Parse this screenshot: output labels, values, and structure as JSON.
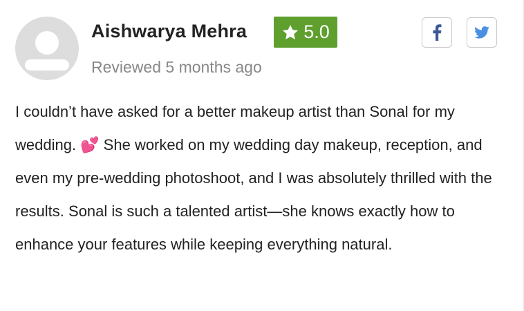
{
  "review": {
    "reviewer_name": "Aishwarya Mehra",
    "rating": "5.0",
    "meta": "Reviewed 5 months ago",
    "body": "I couldn’t have asked for a better makeup artist than Sonal for my wedding. 💕 She worked on my wedding day makeup, reception, and even my pre-wedding photoshoot, and I was absolutely thrilled with the results. Sonal is such a talented artist—she knows exactly how to enhance your features while keeping everything natural."
  },
  "icons": {
    "avatar": "default-user-avatar-icon",
    "rating": "star-icon",
    "share_facebook": "facebook-icon",
    "share_twitter": "twitter-icon"
  },
  "colors": {
    "rating_badge": "#5e9f2e",
    "facebook": "#3b5998",
    "twitter": "#4a90e2",
    "meta_text": "#888888",
    "avatar_bg": "#dddddd"
  }
}
